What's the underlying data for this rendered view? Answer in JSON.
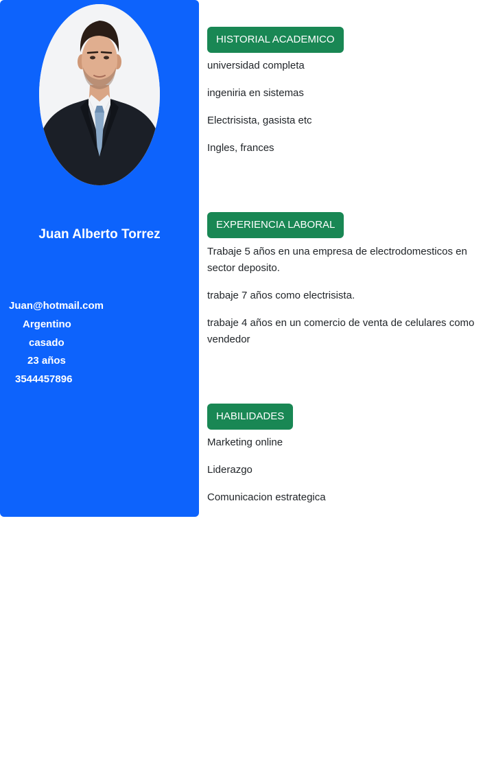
{
  "profile": {
    "name": "Juan Alberto Torrez",
    "contact": {
      "email": "Juan@hotmail.com",
      "nationality": "Argentino",
      "civil_status": "casado",
      "age": "23 años",
      "phone": "3544457896"
    }
  },
  "sections": {
    "academic": {
      "title": "HISTORIAL ACADEMICO",
      "items": [
        "universidad completa",
        "ingeniria en sistemas",
        "Electrisista, gasista etc",
        "Ingles, frances"
      ]
    },
    "experience": {
      "title": "EXPERIENCIA LABORAL",
      "items": [
        "Trabaje 5 años en una empresa de electrodomesticos en sector deposito.",
        "trabaje 7 años como electrisista.",
        "trabaje 4 años en un comercio de venta de celulares como vendedor"
      ]
    },
    "skills": {
      "title": "HABILIDADES",
      "items": [
        "Marketing online",
        "Liderazgo",
        "Comunicacion estrategica"
      ]
    }
  },
  "colors": {
    "sidebar": "#0d63fc",
    "section_badge": "#198754",
    "text": "#212529"
  }
}
